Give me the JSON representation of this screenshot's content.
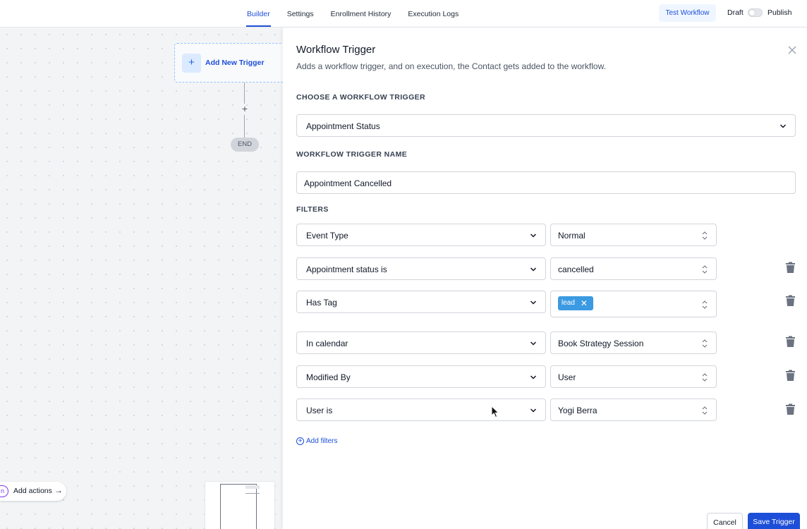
{
  "nav": {
    "tabs": [
      {
        "label": "Builder",
        "active": true
      },
      {
        "label": "Settings"
      },
      {
        "label": "Enrollment History"
      },
      {
        "label": "Execution Logs"
      }
    ],
    "test_workflow": "Test Workflow",
    "draft": "Draft",
    "publish": "Publish"
  },
  "canvas": {
    "add_trigger": "Add New Trigger",
    "end": "END",
    "actions_badge": "n",
    "add_actions": "Add actions"
  },
  "panel": {
    "title": "Workflow Trigger",
    "description": "Adds a workflow trigger, and on execution, the Contact gets added to the workflow.",
    "choose_label": "CHOOSE A WORKFLOW TRIGGER",
    "trigger_type": "Appointment Status",
    "name_label": "WORKFLOW TRIGGER NAME",
    "trigger_name": "Appointment Cancelled",
    "filters_label": "FILTERS",
    "filters": [
      {
        "field": "Event Type",
        "value": "Normal"
      },
      {
        "field": "Appointment status is",
        "value": "cancelled"
      },
      {
        "field": "Has Tag",
        "tag": "lead"
      },
      {
        "field": "In calendar",
        "value": "Book Strategy Session"
      },
      {
        "field": "Modified By",
        "value": "User"
      },
      {
        "field": "User is",
        "value": "Yogi Berra"
      }
    ],
    "add_filters": "Add filters",
    "cancel": "Cancel",
    "save": "Save Trigger"
  },
  "colors": {
    "accent": "#1d4ed8",
    "tag": "#3b9ae1",
    "canvas_bg": "#f3f4f6"
  }
}
